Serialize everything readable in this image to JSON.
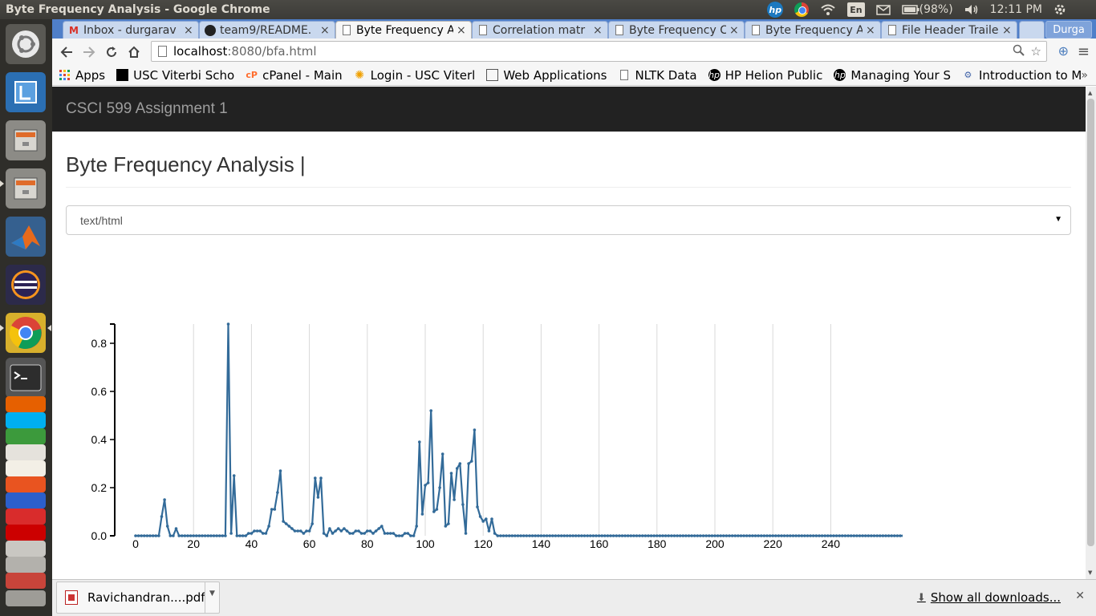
{
  "system": {
    "window_title": "Byte Frequency Analysis - Google Chrome",
    "language": "En",
    "battery": "(98%)",
    "time": "12:11 PM"
  },
  "tabs": [
    {
      "label": "Inbox - durgarav",
      "icon": "gmail-icon"
    },
    {
      "label": "team9/README.",
      "icon": "github-icon"
    },
    {
      "label": "Byte Frequency A",
      "icon": "page-icon",
      "active": true
    },
    {
      "label": "Correlation matr",
      "icon": "page-icon"
    },
    {
      "label": "Byte Frequency C",
      "icon": "page-icon"
    },
    {
      "label": "Byte Frequency A",
      "icon": "page-icon"
    },
    {
      "label": "File Header Traile",
      "icon": "page-icon"
    }
  ],
  "profile_name": "Durga",
  "address": {
    "host": "localhost",
    "path": ":8080/bfa.html"
  },
  "bookmarks": [
    {
      "label": "Apps",
      "icon": "apps-grid-icon"
    },
    {
      "label": "USC Viterbi Scho",
      "icon": "usc-icon"
    },
    {
      "label": "cPanel - Main",
      "icon": "cpanel-icon"
    },
    {
      "label": "Login - USC Viterl",
      "icon": "usc-sun-icon"
    },
    {
      "label": "Web Applications",
      "icon": "webapps-icon"
    },
    {
      "label": "NLTK Data",
      "icon": "page-icon"
    },
    {
      "label": "HP Helion Public",
      "icon": "hp-icon"
    },
    {
      "label": "Managing Your S",
      "icon": "hp-icon"
    },
    {
      "label": "Introduction to M",
      "icon": "intro-icon"
    }
  ],
  "bookmarks_overflow": "»",
  "app": {
    "brand": "CSCI 599 Assignment 1",
    "page_title": "Byte Frequency Analysis |",
    "selected_type": "text/html"
  },
  "chart_data": {
    "type": "line",
    "title": "",
    "xlabel": "",
    "ylabel": "",
    "xlim": [
      0,
      255
    ],
    "ylim": [
      0,
      0.88
    ],
    "x_ticks": [
      0,
      20,
      40,
      60,
      80,
      100,
      120,
      140,
      160,
      180,
      200,
      220,
      240
    ],
    "y_ticks": [
      0.0,
      0.2,
      0.4,
      0.6,
      0.8
    ],
    "y_tick_labels": [
      "0.0",
      "0.2",
      "0.4",
      "0.6",
      "0.8"
    ],
    "grid": "vertical",
    "series_color": "#336b99",
    "x": "0..255",
    "values": [
      0,
      0,
      0,
      0,
      0,
      0,
      0,
      0,
      0,
      0.08,
      0.15,
      0.04,
      0,
      0,
      0.03,
      0,
      0,
      0,
      0,
      0,
      0,
      0,
      0,
      0,
      0,
      0,
      0,
      0,
      0,
      0,
      0,
      0,
      0.88,
      0.01,
      0.25,
      0,
      0,
      0,
      0,
      0.01,
      0.01,
      0.02,
      0.02,
      0.02,
      0.01,
      0.01,
      0.04,
      0.11,
      0.11,
      0.18,
      0.27,
      0.06,
      0.05,
      0.04,
      0.03,
      0.02,
      0.02,
      0.02,
      0.01,
      0.02,
      0.02,
      0.05,
      0.24,
      0.16,
      0.24,
      0.01,
      0,
      0.03,
      0.01,
      0.02,
      0.03,
      0.02,
      0.03,
      0.02,
      0.01,
      0.01,
      0.02,
      0.02,
      0.01,
      0.01,
      0.02,
      0.02,
      0.01,
      0.02,
      0.03,
      0.04,
      0.01,
      0.01,
      0.01,
      0.01,
      0,
      0,
      0,
      0.01,
      0.01,
      0,
      0,
      0.04,
      0.39,
      0.09,
      0.21,
      0.22,
      0.52,
      0.1,
      0.11,
      0.2,
      0.34,
      0.04,
      0.05,
      0.26,
      0.15,
      0.28,
      0.3,
      0.13,
      0.01,
      0.3,
      0.31,
      0.44,
      0.12,
      0.08,
      0.06,
      0.07,
      0.02,
      0.07,
      0.01,
      0,
      0,
      0,
      0,
      0,
      0,
      0,
      0,
      0,
      0,
      0,
      0,
      0,
      0,
      0,
      0,
      0,
      0,
      0,
      0,
      0,
      0,
      0,
      0,
      0,
      0,
      0,
      0,
      0,
      0,
      0,
      0,
      0,
      0,
      0,
      0,
      0,
      0,
      0,
      0,
      0,
      0,
      0,
      0,
      0,
      0,
      0,
      0,
      0,
      0,
      0,
      0,
      0,
      0,
      0,
      0,
      0,
      0,
      0,
      0,
      0,
      0,
      0,
      0,
      0,
      0,
      0,
      0,
      0,
      0,
      0,
      0,
      0,
      0,
      0,
      0,
      0,
      0,
      0,
      0,
      0,
      0,
      0,
      0,
      0,
      0,
      0,
      0,
      0,
      0,
      0,
      0,
      0,
      0,
      0,
      0,
      0,
      0,
      0,
      0,
      0,
      0,
      0,
      0,
      0,
      0,
      0,
      0,
      0,
      0,
      0,
      0,
      0,
      0,
      0,
      0,
      0,
      0,
      0,
      0,
      0,
      0,
      0,
      0,
      0,
      0,
      0,
      0,
      0,
      0,
      0,
      0,
      0,
      0,
      0,
      0,
      0,
      0,
      0,
      0,
      0,
      0,
      0,
      0,
      0
    ]
  },
  "downloads": {
    "file_name": "Ravichandran....pdf",
    "show_all": "Show all downloads..."
  }
}
